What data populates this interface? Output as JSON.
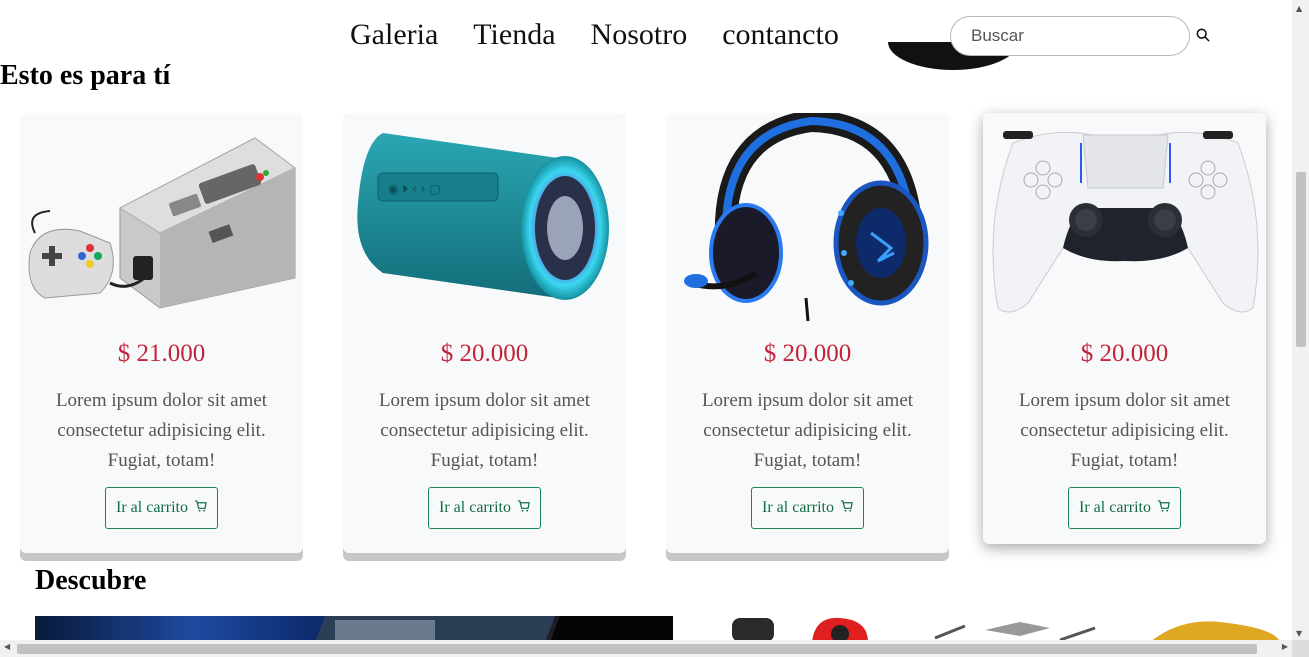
{
  "nav": {
    "items": [
      {
        "label": "Galeria"
      },
      {
        "label": "Tienda"
      },
      {
        "label": "Nosotro"
      },
      {
        "label": "contancto"
      }
    ],
    "search_placeholder": "Buscar"
  },
  "sections": {
    "featured_title": "Esto es para tí",
    "discover_title": "Descubre"
  },
  "products": [
    {
      "icon": "retro-console-image",
      "price": "$ 21.000",
      "description": "Lorem ipsum dolor sit amet consectetur adipisicing elit. Fugiat, totam!",
      "button": "Ir al carrito"
    },
    {
      "icon": "bluetooth-speaker-image",
      "price": "$ 20.000",
      "description": "Lorem ipsum dolor sit amet consectetur adipisicing elit. Fugiat, totam!",
      "button": "Ir al carrito"
    },
    {
      "icon": "gaming-headset-image",
      "price": "$ 20.000",
      "description": "Lorem ipsum dolor sit amet consectetur adipisicing elit. Fugiat, totam!",
      "button": "Ir al carrito"
    },
    {
      "icon": "gamepad-controller-image",
      "price": "$ 20.000",
      "description": "Lorem ipsum dolor sit amet consectetur adipisicing elit. Fugiat, totam!",
      "button": "Ir al carrito"
    }
  ],
  "colors": {
    "price": "#c0263a",
    "button_border": "#198754",
    "card_bg": "#f8f9fb"
  }
}
